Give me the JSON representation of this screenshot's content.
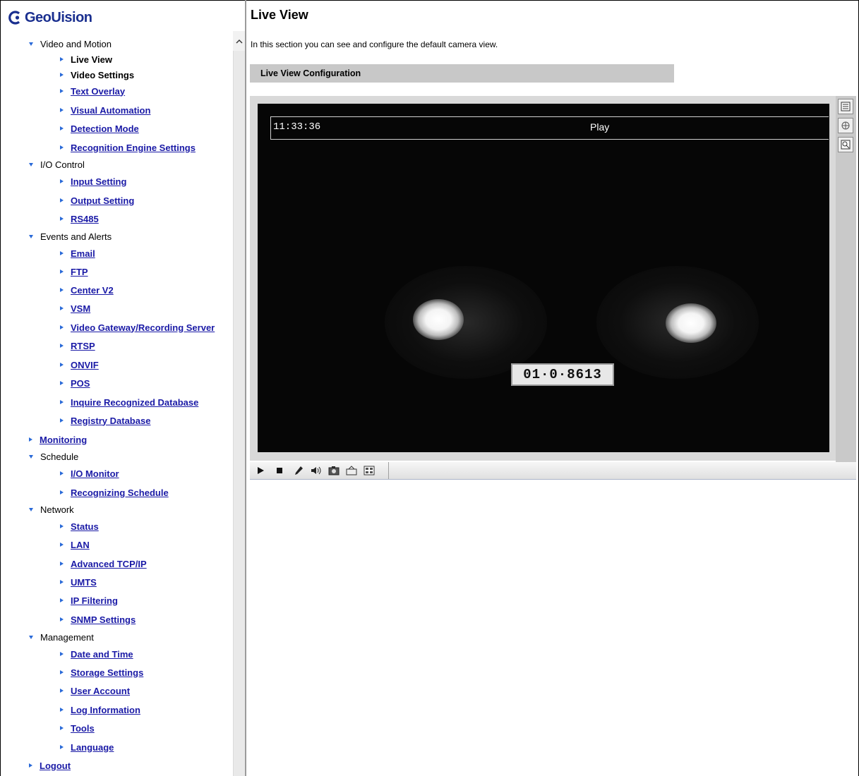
{
  "logo": {
    "text": "GeoUision"
  },
  "nav": [
    {
      "level": 0,
      "label": "Video and Motion",
      "expanded": true,
      "type": "group"
    },
    {
      "level": 1,
      "label": "Live View",
      "type": "current"
    },
    {
      "level": 1,
      "label": "Video Settings",
      "type": "current"
    },
    {
      "level": 1,
      "label": "Text Overlay",
      "type": "link"
    },
    {
      "level": 1,
      "label": "Visual Automation",
      "type": "link"
    },
    {
      "level": 1,
      "label": "Detection Mode",
      "type": "link"
    },
    {
      "level": 1,
      "label": "Recognition Engine Settings",
      "type": "link"
    },
    {
      "level": 0,
      "label": "I/O Control",
      "expanded": true,
      "type": "group"
    },
    {
      "level": 1,
      "label": "Input Setting",
      "type": "link"
    },
    {
      "level": 1,
      "label": "Output Setting",
      "type": "link"
    },
    {
      "level": 1,
      "label": "RS485",
      "type": "link"
    },
    {
      "level": 0,
      "label": "Events and Alerts",
      "expanded": true,
      "type": "group"
    },
    {
      "level": 1,
      "label": "Email",
      "type": "link"
    },
    {
      "level": 1,
      "label": "FTP",
      "type": "link"
    },
    {
      "level": 1,
      "label": "Center V2",
      "type": "link"
    },
    {
      "level": 1,
      "label": "VSM",
      "type": "link"
    },
    {
      "level": 1,
      "label": "Video Gateway/Recording Server",
      "type": "link"
    },
    {
      "level": 1,
      "label": "RTSP",
      "type": "link"
    },
    {
      "level": 1,
      "label": "ONVIF",
      "type": "link"
    },
    {
      "level": 1,
      "label": "POS",
      "type": "link"
    },
    {
      "level": 1,
      "label": "Inquire Recognized Database",
      "type": "link"
    },
    {
      "level": 1,
      "label": "Registry Database",
      "type": "link"
    },
    {
      "level": 0,
      "label": "Monitoring",
      "expanded": false,
      "type": "link"
    },
    {
      "level": 0,
      "label": "Schedule",
      "expanded": true,
      "type": "group"
    },
    {
      "level": 1,
      "label": "I/O Monitor",
      "type": "link"
    },
    {
      "level": 1,
      "label": "Recognizing Schedule",
      "type": "link"
    },
    {
      "level": 0,
      "label": "Network",
      "expanded": true,
      "type": "group"
    },
    {
      "level": 1,
      "label": "Status",
      "type": "link"
    },
    {
      "level": 1,
      "label": "LAN",
      "type": "link"
    },
    {
      "level": 1,
      "label": "Advanced TCP/IP",
      "type": "link"
    },
    {
      "level": 1,
      "label": "UMTS",
      "type": "link"
    },
    {
      "level": 1,
      "label": "IP Filtering",
      "type": "link"
    },
    {
      "level": 1,
      "label": "SNMP Settings",
      "type": "link"
    },
    {
      "level": 0,
      "label": "Management",
      "expanded": true,
      "type": "group"
    },
    {
      "level": 1,
      "label": "Date and Time",
      "type": "link"
    },
    {
      "level": 1,
      "label": "Storage Settings",
      "type": "link"
    },
    {
      "level": 1,
      "label": "User Account",
      "type": "link"
    },
    {
      "level": 1,
      "label": "Log Information",
      "type": "link"
    },
    {
      "level": 1,
      "label": "Tools",
      "type": "link"
    },
    {
      "level": 1,
      "label": "Language",
      "type": "link"
    },
    {
      "level": 0,
      "label": "Logout",
      "expanded": false,
      "type": "link"
    }
  ],
  "main": {
    "title": "Live View",
    "intro": "In this section you can see and configure the default camera view.",
    "section_title": "Live View Configuration"
  },
  "viewer": {
    "time": "11:33:36",
    "status": "Play",
    "plate": "01·0·8613"
  },
  "controls": {
    "play_icon": "play-icon",
    "stop_icon": "stop-icon",
    "mic_icon": "microphone-icon",
    "speaker_icon": "speaker-icon",
    "snapshot_icon": "snapshot-icon",
    "record_icon": "record-icon",
    "fullscreen_icon": "fullscreen-icon"
  }
}
